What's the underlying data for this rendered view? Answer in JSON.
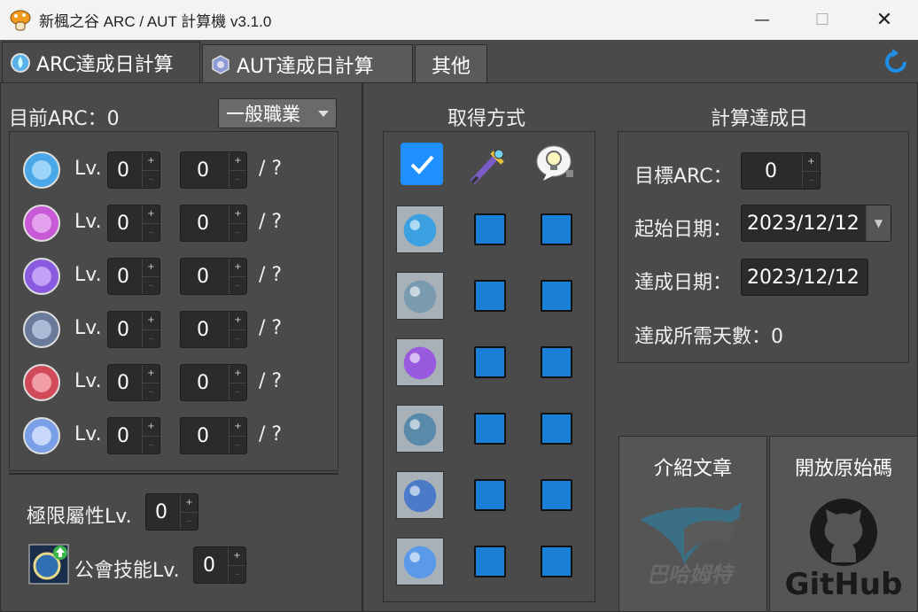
{
  "window": {
    "title": "新楓之谷 ARC / AUT 計算機  v3.1.0"
  },
  "tabs": [
    {
      "label": "ARC達成日計算"
    },
    {
      "label": "AUT達成日計算"
    },
    {
      "label": "其他"
    }
  ],
  "left": {
    "current_arc_label": "目前ARC：0",
    "job_select": "一般職業",
    "rows": [
      {
        "lv_label": "Lv.",
        "level": "0",
        "exp": "0",
        "max": "/ ?"
      },
      {
        "lv_label": "Lv.",
        "level": "0",
        "exp": "0",
        "max": "/ ?"
      },
      {
        "lv_label": "Lv.",
        "level": "0",
        "exp": "0",
        "max": "/ ?"
      },
      {
        "lv_label": "Lv.",
        "level": "0",
        "exp": "0",
        "max": "/ ?"
      },
      {
        "lv_label": "Lv.",
        "level": "0",
        "exp": "0",
        "max": "/ ?"
      },
      {
        "lv_label": "Lv.",
        "level": "0",
        "exp": "0",
        "max": "/ ?"
      }
    ],
    "limit_attr_label": "極限屬性Lv.",
    "limit_attr_value": "0",
    "guild_skill_label": "公會技能Lv.",
    "guild_skill_value": "0"
  },
  "middle": {
    "title": "取得方式"
  },
  "right": {
    "title": "計算達成日",
    "target_arc_label": "目標ARC：",
    "target_arc_value": "0",
    "start_date_label": "起始日期：",
    "start_date_value": "2023/12/12",
    "finish_date_label": "達成日期：",
    "finish_date_value": "2023/12/12",
    "days_label": "達成所需天數：0",
    "article_label": "介紹文章",
    "source_label": "開放原始碼",
    "bahamut_text": "巴哈姆特",
    "github_text": "GitHub"
  },
  "colors": {
    "accent": "#1a7fd6",
    "bg": "#4a4a4a"
  }
}
